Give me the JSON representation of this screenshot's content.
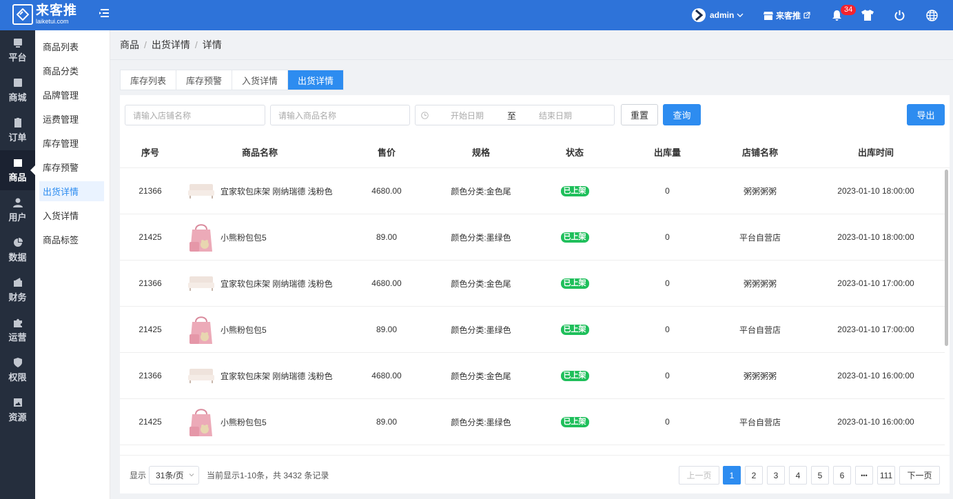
{
  "header": {
    "logo_main": "来客推",
    "logo_sub": "laiketui.com",
    "user": "admin",
    "store": "来客推",
    "notification_count": "34"
  },
  "leftnav": [
    {
      "label": "平台",
      "icon": "platform-icon"
    },
    {
      "label": "商城",
      "icon": "mall-icon"
    },
    {
      "label": "订单",
      "icon": "order-icon"
    },
    {
      "label": "商品",
      "icon": "goods-icon",
      "active": true
    },
    {
      "label": "用户",
      "icon": "user-icon"
    },
    {
      "label": "数据",
      "icon": "chart-pie-icon"
    },
    {
      "label": "财务",
      "icon": "wallet-icon"
    },
    {
      "label": "运营",
      "icon": "puzzle-icon"
    },
    {
      "label": "权限",
      "icon": "shield-icon"
    },
    {
      "label": "资源",
      "icon": "image-icon"
    }
  ],
  "subnav": [
    "商品列表",
    "商品分类",
    "品牌管理",
    "运费管理",
    "库存管理",
    "库存预警",
    "出货详情",
    "入货详情",
    "商品标签"
  ],
  "breadcrumb": [
    "商品",
    "出货详情",
    "详情"
  ],
  "tabs": [
    "库存列表",
    "库存预警",
    "入货详情",
    "出货详情"
  ],
  "filters": {
    "store_placeholder": "请输入店铺名称",
    "product_placeholder": "请输入商品名称",
    "start_date": "开始日期",
    "to": "至",
    "end_date": "结束日期",
    "reset": "重置",
    "query": "查询",
    "export": "导出"
  },
  "columns": [
    "序号",
    "商品名称",
    "售价",
    "规格",
    "状态",
    "出库量",
    "店铺名称",
    "出库时间"
  ],
  "rows": [
    {
      "id": "21366",
      "name": "宜家软包床架 刚纳瑞德 浅粉色",
      "img": "bed",
      "price": "4680.00",
      "spec": "颜色分类:金色尾",
      "status": "已上架",
      "qty": "0",
      "store": "粥粥粥粥",
      "time": "2023-01-10 18:00:00"
    },
    {
      "id": "21425",
      "name": "小熊粉包包5",
      "img": "bag",
      "price": "89.00",
      "spec": "颜色分类:墨绿色",
      "status": "已上架",
      "qty": "0",
      "store": "平台自营店",
      "time": "2023-01-10 18:00:00"
    },
    {
      "id": "21366",
      "name": "宜家软包床架 刚纳瑞德 浅粉色",
      "img": "bed",
      "price": "4680.00",
      "spec": "颜色分类:金色尾",
      "status": "已上架",
      "qty": "0",
      "store": "粥粥粥粥",
      "time": "2023-01-10 17:00:00"
    },
    {
      "id": "21425",
      "name": "小熊粉包包5",
      "img": "bag",
      "price": "89.00",
      "spec": "颜色分类:墨绿色",
      "status": "已上架",
      "qty": "0",
      "store": "平台自营店",
      "time": "2023-01-10 17:00:00"
    },
    {
      "id": "21366",
      "name": "宜家软包床架 刚纳瑞德 浅粉色",
      "img": "bed",
      "price": "4680.00",
      "spec": "颜色分类:金色尾",
      "status": "已上架",
      "qty": "0",
      "store": "粥粥粥粥",
      "time": "2023-01-10 16:00:00"
    },
    {
      "id": "21425",
      "name": "小熊粉包包5",
      "img": "bag",
      "price": "89.00",
      "spec": "颜色分类:墨绿色",
      "status": "已上架",
      "qty": "0",
      "store": "平台自营店",
      "time": "2023-01-10 16:00:00"
    }
  ],
  "pagination": {
    "show": "显示",
    "page_size": "31条/页",
    "summary": "当前显示1-10条，共 3432 条记录",
    "prev": "上一页",
    "pages": [
      "1",
      "2",
      "3",
      "4",
      "5",
      "6"
    ],
    "ellipsis": "•••",
    "last": "111",
    "next": "下一页"
  }
}
